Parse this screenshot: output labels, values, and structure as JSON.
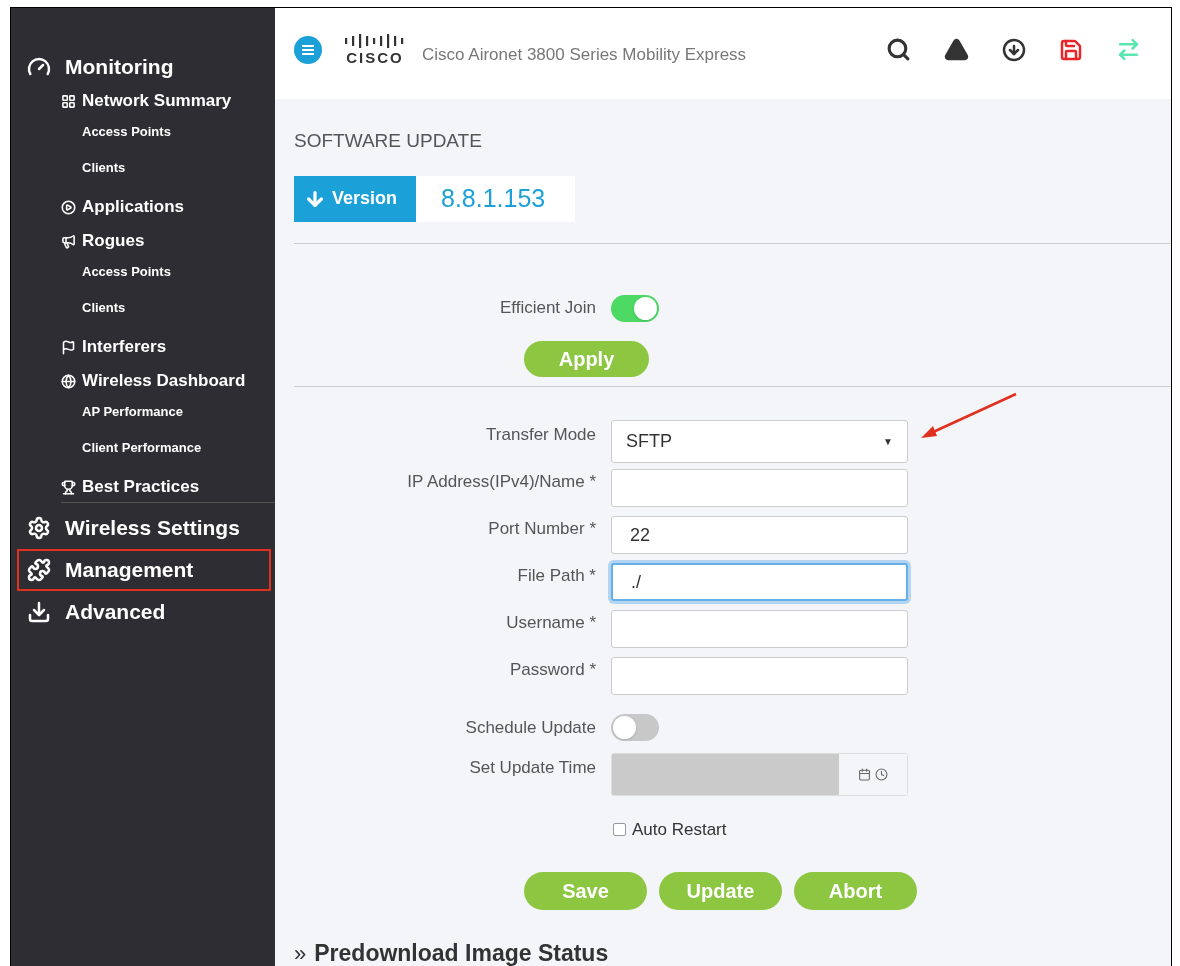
{
  "sidebar": {
    "items": [
      {
        "label": "Monitoring",
        "highlighted": false,
        "children": [
          {
            "label": "Network Summary",
            "children": [
              {
                "label": "Access Points"
              },
              {
                "label": "Clients"
              }
            ]
          },
          {
            "label": "Applications"
          },
          {
            "label": "Rogues",
            "children": [
              {
                "label": "Access Points"
              },
              {
                "label": "Clients"
              }
            ]
          },
          {
            "label": "Interferers"
          },
          {
            "label": "Wireless Dashboard",
            "children": [
              {
                "label": "AP Performance"
              },
              {
                "label": "Client Performance"
              }
            ]
          },
          {
            "label": "Best Practices"
          }
        ]
      },
      {
        "label": "Wireless Settings",
        "highlighted": false
      },
      {
        "label": "Management",
        "highlighted": true
      },
      {
        "label": "Advanced",
        "highlighted": false
      }
    ]
  },
  "header": {
    "logo_text": "CISCO",
    "title": "Cisco Aironet 3800 Series Mobility Express"
  },
  "page_title": "SOFTWARE UPDATE",
  "version": {
    "label": "Version",
    "value": "8.8.1.153"
  },
  "efficient_join": {
    "label": "Efficient Join",
    "on": true
  },
  "apply_button": "Apply",
  "form": [
    {
      "kind": "select",
      "label": "Transfer Mode",
      "value": "SFTP",
      "caret": "▼"
    },
    {
      "kind": "input",
      "label": "IP Address(IPv4)/Name *",
      "focused": false
    },
    {
      "kind": "input",
      "label": "Port Number *",
      "value": "22",
      "focused": false
    },
    {
      "kind": "input",
      "label": "File Path *",
      "value": "./",
      "focused": true
    },
    {
      "kind": "input",
      "label": "Username *",
      "focused": false
    },
    {
      "kind": "input",
      "label": "Password *",
      "focused": false
    },
    {
      "kind": "toggle",
      "label": "Schedule Update",
      "on": false
    },
    {
      "kind": "datetime",
      "label": "Set Update Time",
      "disabled": true
    }
  ],
  "auto_restart": {
    "label": "Auto Restart",
    "checked": false
  },
  "buttons": [
    "Save",
    "Update",
    "Abort"
  ],
  "section": {
    "marker": "»",
    "title": "Predownload Image Status"
  }
}
